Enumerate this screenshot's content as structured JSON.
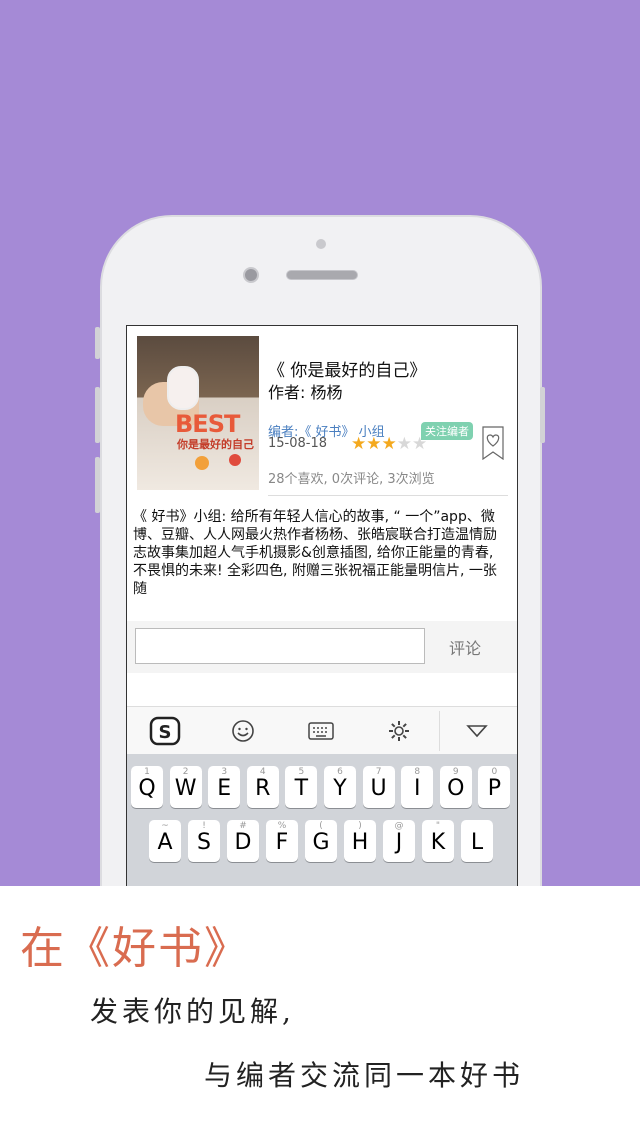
{
  "book": {
    "title": "《 你是最好的自己》",
    "author": "作者: 杨杨",
    "editor": "编者:《 好书》 小组",
    "follow_label": "关注编者",
    "date": "15-08-18",
    "rating": 3,
    "rating_max": 5,
    "stats": "28个喜欢, 0次评论, 3次浏览",
    "cover_best": "BEST",
    "cover_subtitle": "你是最好的自己"
  },
  "description": "《 好书》小组: 给所有年轻人信心的故事, “ 一个”app、微博、豆瓣、人人网最火热作者杨杨、张皓宸联合打造温情励志故事集加超人气手机摄影&创意插图, 给你正能量的青春, 不畏惧的未来! 全彩四色, 附赠三张祝福正能量明信片, 一张随",
  "comment": {
    "placeholder": "",
    "submit_label": "评论"
  },
  "toolbar": {
    "icons": [
      "sogou-logo-icon",
      "emoji-icon",
      "keyboard-icon",
      "settings-icon",
      "collapse-icon"
    ]
  },
  "keyboard": {
    "row1": [
      {
        "key": "Q",
        "num": "1"
      },
      {
        "key": "W",
        "num": "2"
      },
      {
        "key": "E",
        "num": "3"
      },
      {
        "key": "R",
        "num": "4"
      },
      {
        "key": "T",
        "num": "5"
      },
      {
        "key": "Y",
        "num": "6"
      },
      {
        "key": "U",
        "num": "7"
      },
      {
        "key": "I",
        "num": "8"
      },
      {
        "key": "O",
        "num": "9"
      },
      {
        "key": "P",
        "num": "0"
      }
    ],
    "row2": [
      {
        "key": "A",
        "num": "~"
      },
      {
        "key": "S",
        "num": "!"
      },
      {
        "key": "D",
        "num": "#"
      },
      {
        "key": "F",
        "num": "%"
      },
      {
        "key": "G",
        "num": "("
      },
      {
        "key": "H",
        "num": ")"
      },
      {
        "key": "J",
        "num": "@"
      },
      {
        "key": "K",
        "num": "\""
      },
      {
        "key": "L",
        "num": ""
      }
    ]
  },
  "banner": {
    "title": "在《好书》",
    "line1": "发表你的见解,",
    "line2": "与编者交流同一本好书"
  },
  "colors": {
    "background": "#a58ad6",
    "star_on": "#f4a91e",
    "follow_badge": "#7fd1b0",
    "banner_title": "#d96c50"
  }
}
